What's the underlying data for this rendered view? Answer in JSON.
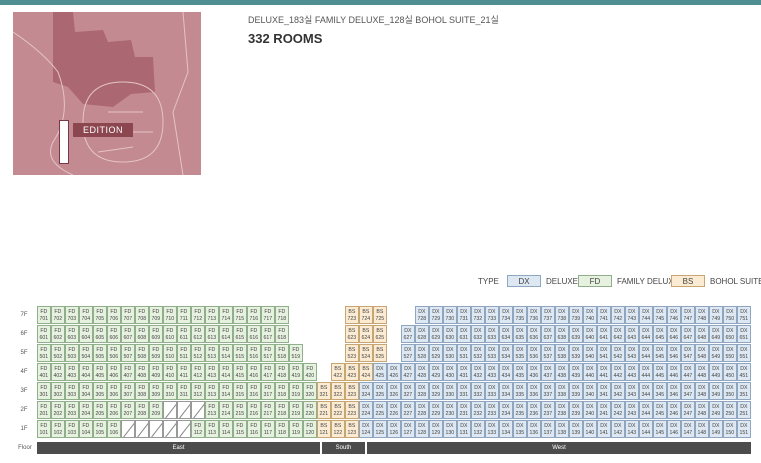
{
  "header": {
    "counts_text": "DELUXE_183실  FAMILY DELUXE_128실  BOHOL SUITE_21실",
    "total_text": "332 ROOMS"
  },
  "map": {
    "label": "EDITION"
  },
  "legend": {
    "title": "TYPE",
    "items": [
      {
        "code": "DX",
        "name": "DELUXE",
        "color": "#dde8f2"
      },
      {
        "code": "FD",
        "name": "FAMILY DELUXE",
        "color": "#e6f2df"
      },
      {
        "code": "BS",
        "name": "BOHOL SUITE",
        "color": "#fbebd2"
      }
    ]
  },
  "floor_header": "Floor",
  "sections": [
    "East",
    "South",
    "West"
  ],
  "floors": [
    {
      "label": "7F",
      "num": 7,
      "cells": "FFFFFFFFFFFFFFFFFF____BBB__DDDDDDDDDDDDDDDDDDDDDDDD"
    },
    {
      "label": "6F",
      "num": 6,
      "cells": "FFFFFFFFFFFFFFFFFF____BBB_DDDDDDDDDDDDDDDDDDDDDDDDD"
    },
    {
      "label": "5F",
      "num": 5,
      "cells": "FFFFFFFFFFFFFFFFFFF___BBB_DDDDDDDDDDDDDDDDDDDDDDDDD"
    },
    {
      "label": "4F",
      "num": 4,
      "cells": "FFFFFFFFFFFFFFFFFFFF_BBBDDDDDDDDDDDDDDDDDDDDDDDDDDD"
    },
    {
      "label": "3F",
      "num": 3,
      "cells": "FFFFFFFFFFFFFFFFFFFFBBBDDDDDDDDDDDDDDDDDDDDDDDDDDDD"
    },
    {
      "label": "2F",
      "num": 2,
      "cells": "FFFFFFFFFXXXFFFFFFFFBBBDDDDDDDDDDDDDDDDDDDDDDDDDDDD"
    },
    {
      "label": "1F",
      "num": 1,
      "cells": "FFFFFFXXXXXFFFFFFFFFBBBDDDDDDDDDDDDDDDDDDDDDDDDDDDD"
    }
  ]
}
